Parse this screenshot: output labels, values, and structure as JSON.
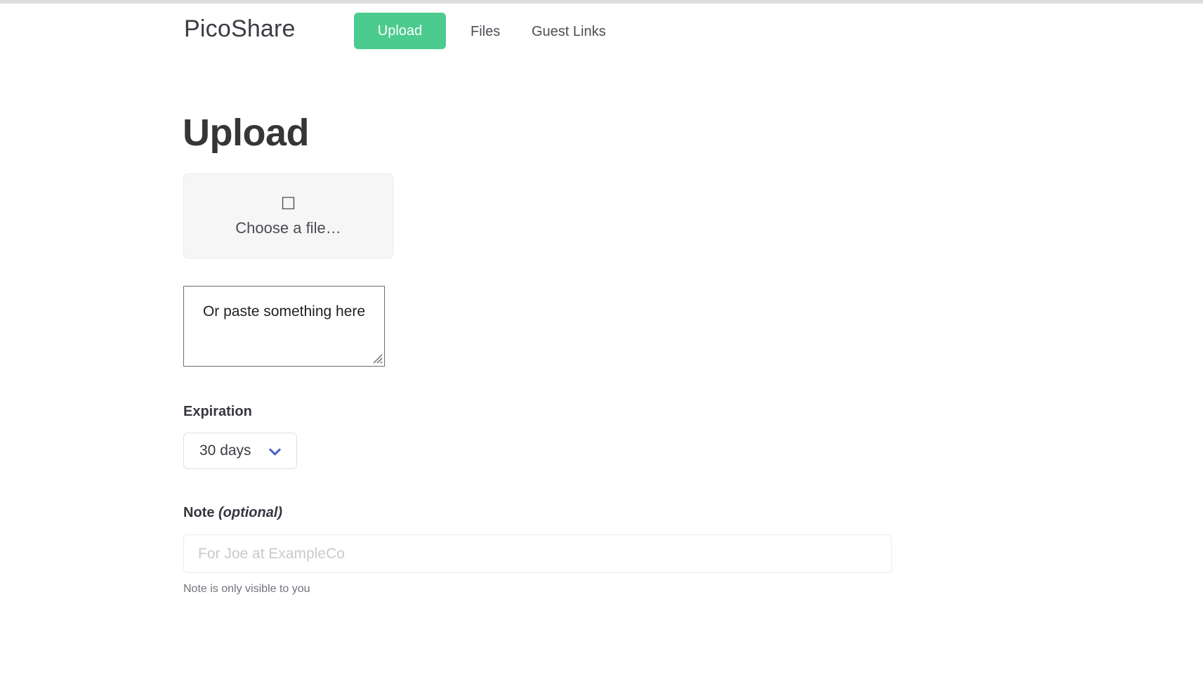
{
  "navbar": {
    "brand": "PicoShare",
    "upload_label": "Upload",
    "links": [
      {
        "label": "Files"
      },
      {
        "label": "Guest Links"
      }
    ]
  },
  "main": {
    "title": "Upload",
    "file_picker": {
      "icon": "upload-icon",
      "icon_glyph": "☐",
      "label": "Choose a file…"
    },
    "paste_area": {
      "value": "Or paste something here",
      "placeholder": "Or paste something here"
    },
    "expiration": {
      "label": "Expiration",
      "selected": "30 days",
      "chevron_icon": "chevron-down-icon"
    },
    "note": {
      "label": "Note ",
      "optional": "(optional)",
      "value": "",
      "placeholder": "For Joe at ExampleCo",
      "help": "Note is only visible to you"
    }
  },
  "colors": {
    "accent_green": "#4ccb8f",
    "chevron_blue": "#4f5fcf",
    "heading": "#363636",
    "muted_text": "#72727c",
    "placeholder": "#c9c9ce",
    "top_strip": "#dcdcdc"
  }
}
